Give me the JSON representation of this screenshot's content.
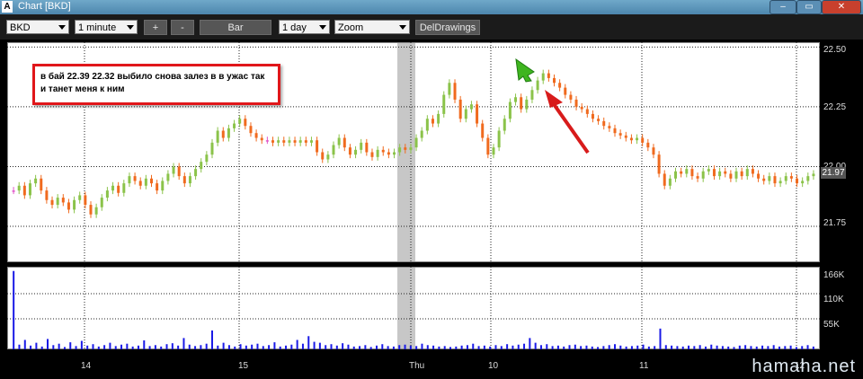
{
  "window": {
    "title": "Chart [BKD]",
    "logo": "A",
    "controls": [
      "–",
      "▭",
      "✕"
    ]
  },
  "toolbar": {
    "symbol": "BKD",
    "interval": "1 minute",
    "plus": "+",
    "minus": "-",
    "chart_type": "Bar",
    "period": "1 day",
    "zoom": "Zoom",
    "del_drawings": "DelDrawings"
  },
  "price_axis": {
    "labels": [
      "22.50",
      "22.25",
      "22.00",
      "21.75"
    ],
    "last_price": "21.97"
  },
  "volume_axis": {
    "labels": [
      "166K",
      "110K",
      "55K"
    ]
  },
  "time_axis": {
    "labels": [
      "14",
      "15",
      "Thu",
      "10",
      "11",
      "12"
    ]
  },
  "annotation": {
    "text": "в бай 22.39 22.32 выбило снова залез в в ужас так и танет меня к ним"
  },
  "watermark": "hamaha.net",
  "colors": {
    "up": "#8bc34a",
    "down": "#f06a1e",
    "flat": "#e055c8",
    "volume": "#1a1ae6",
    "arrow_red": "#d81b1b",
    "arrow_green": "#3fb51f"
  },
  "chart_data": {
    "type": "candlestick",
    "ylim": [
      21.6,
      22.52
    ],
    "yticks": [
      21.75,
      22.0,
      22.25,
      22.5
    ],
    "price_path": [
      21.9,
      21.92,
      21.88,
      21.93,
      21.95,
      21.9,
      21.86,
      21.84,
      21.87,
      21.85,
      21.82,
      21.86,
      21.88,
      21.84,
      21.8,
      21.83,
      21.87,
      21.9,
      21.92,
      21.89,
      21.93,
      21.96,
      21.94,
      21.92,
      21.95,
      21.93,
      21.9,
      21.94,
      21.97,
      22.0,
      21.96,
      21.93,
      21.96,
      21.99,
      22.02,
      22.05,
      22.1,
      22.15,
      22.12,
      22.16,
      22.18,
      22.2,
      22.17,
      22.14,
      22.12,
      22.11,
      22.11,
      22.1,
      22.11,
      22.1,
      22.11,
      22.1,
      22.11,
      22.1,
      22.11,
      22.06,
      22.03,
      22.05,
      22.09,
      22.12,
      22.08,
      22.05,
      22.07,
      22.1,
      22.06,
      22.04,
      22.07,
      22.06,
      22.05,
      22.06,
      22.08,
      22.07,
      22.08,
      22.12,
      22.15,
      22.2,
      22.18,
      22.22,
      22.3,
      22.35,
      22.28,
      22.2,
      22.24,
      22.26,
      22.18,
      22.12,
      22.05,
      22.08,
      22.15,
      22.2,
      22.27,
      22.29,
      22.24,
      22.28,
      22.32,
      22.36,
      22.39,
      22.37,
      22.35,
      22.33,
      22.3,
      22.28,
      22.25,
      22.24,
      22.22,
      22.2,
      22.19,
      22.17,
      22.16,
      22.14,
      22.13,
      22.12,
      22.11,
      22.12,
      22.1,
      22.08,
      22.05,
      21.97,
      21.92,
      21.95,
      21.98,
      21.97,
      21.99,
      21.96,
      21.95,
      21.98,
      21.99,
      21.96,
      21.98,
      21.97,
      21.95,
      21.98,
      21.96,
      21.99,
      21.97,
      21.95,
      21.94,
      21.96,
      21.93,
      21.94,
      21.96,
      21.95,
      21.93,
      21.94,
      21.96,
      21.97
    ],
    "volume_path": [
      166,
      10,
      20,
      8,
      14,
      6,
      22,
      9,
      12,
      5,
      15,
      7,
      18,
      8,
      11,
      6,
      9,
      14,
      7,
      10,
      12,
      6,
      8,
      19,
      7,
      9,
      6,
      11,
      13,
      8,
      24,
      10,
      7,
      9,
      12,
      40,
      8,
      14,
      9,
      6,
      11,
      8,
      10,
      12,
      7,
      9,
      15,
      6,
      8,
      10,
      20,
      12,
      28,
      16,
      14,
      9,
      11,
      8,
      13,
      10,
      6,
      7,
      9,
      5,
      8,
      11,
      7,
      6,
      9,
      10,
      8,
      7,
      12,
      9,
      8,
      6,
      7,
      5,
      6,
      8,
      9,
      12,
      7,
      8,
      6,
      9,
      7,
      11,
      8,
      10,
      12,
      24,
      14,
      9,
      11,
      7,
      8,
      6,
      9,
      10,
      7,
      8,
      6,
      5,
      7,
      9,
      11,
      8,
      6,
      7,
      8,
      10,
      6,
      7,
      44,
      9,
      8,
      7,
      6,
      8,
      7,
      9,
      6,
      10,
      8,
      7,
      6,
      5,
      8,
      9,
      7,
      6,
      8,
      7,
      9,
      6,
      7,
      8,
      5,
      7,
      9,
      6
    ],
    "volume_ylim": [
      0,
      175
    ]
  }
}
